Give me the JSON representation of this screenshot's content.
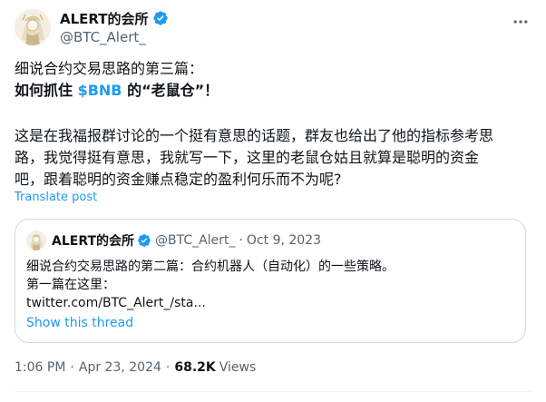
{
  "author": {
    "name": "ALERT的会所",
    "handle": "@BTC_Alert_",
    "verified_color": "#1d9bf0"
  },
  "tweet": {
    "line1": "细说合约交易思路的第三篇：",
    "line2_prefix": "如何抓住 ",
    "line2_cashtag": "$BNB",
    "line2_suffix": " 的“老鼠仓”！",
    "line3": "这是在我福报群讨论的一个挺有意思的话题，群友也给出了他的指标参考思",
    "line4": "路，我觉得挺有意思，我就写一下，这里的老鼠仓姑且就算是聪明的资金",
    "line5": "吧，跟着聪明的资金赚点稳定的盈利何乐而不为呢?",
    "translate_label": "Translate post"
  },
  "quote": {
    "name": "ALERT的会所",
    "handle": "@BTC_Alert_",
    "dot": "·",
    "date": "Oct 9, 2023",
    "line1": "细说合约交易思路的第二篇：合约机器人（自动化）的一些策略。",
    "line2": "第一篇在这里：",
    "line3": "twitter.com/BTC_Alert_/sta...",
    "show_thread": "Show this thread"
  },
  "footer": {
    "time": "1:06 PM",
    "dot1": "·",
    "date": "Apr 23, 2024",
    "dot2": "·",
    "views_count": "68.2K",
    "views_label": "Views"
  },
  "icons": {
    "more": "more-horizontal-icon",
    "verified": "verified-badge-icon",
    "avatar": "avatar-illustration"
  }
}
